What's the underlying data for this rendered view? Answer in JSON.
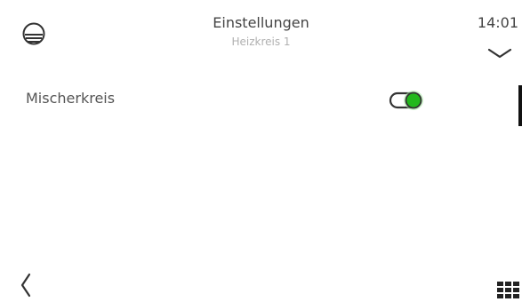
{
  "header": {
    "title": "Einstellungen",
    "subtitle": "Heizkreis 1",
    "time": "14:01"
  },
  "icons": {
    "home": "house-outline-icon",
    "expand": "chevron-down-icon",
    "back": "chevron-left-icon",
    "menu": "grid-menu-icon"
  },
  "settings": {
    "items": [
      {
        "label": "Mischerkreis",
        "enabled": true
      }
    ]
  },
  "colors": {
    "toggle_on": "#22b81c",
    "toggle_glow": "#9de29a",
    "icon": "#333333"
  }
}
